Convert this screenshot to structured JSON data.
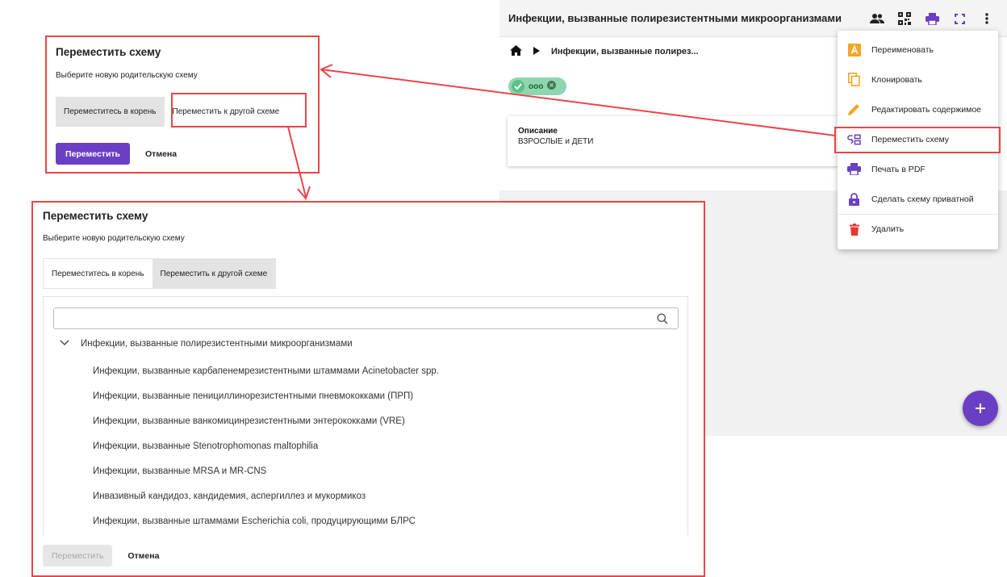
{
  "app": {
    "title": "Инфекции, вызванные полирезистентными микроорганизмами",
    "breadcrumb": "Инфекции, вызванные полирез...",
    "chip_label": "ооо",
    "card_heading": "Описание",
    "card_value": "ВЗРОСЛЫЕ и ДЕТИ",
    "icons": [
      "people-icon",
      "qr-code-icon",
      "print-icon",
      "fullscreen-icon",
      "more-vert-icon"
    ]
  },
  "menu": {
    "items": [
      {
        "label": "Переименовать",
        "icon": "rename-icon"
      },
      {
        "label": "Клонировать",
        "icon": "copy-icon"
      },
      {
        "label": "Редактировать содержимое",
        "icon": "edit-pencil-icon"
      },
      {
        "label": "Переместить схему",
        "icon": "move-scheme-icon"
      },
      {
        "label": "Печать в PDF",
        "icon": "print-icon"
      },
      {
        "label": "Сделать схему приватной",
        "icon": "lock-icon"
      },
      {
        "label": "Удалить",
        "icon": "trash-icon"
      }
    ]
  },
  "small_dialog": {
    "title": "Переместить схему",
    "subtitle": "Выберите новую родительскую схему",
    "tab_root": "Переместитесь в корень",
    "tab_other": "Переместить к другой схеме",
    "move_button": "Переместить",
    "cancel_button": "Отмена"
  },
  "large_dialog": {
    "title": "Переместить схему",
    "subtitle": "Выберите новую родительскую схему",
    "tab_root": "Переместитесь в корень",
    "tab_other": "Переместить к другой схеме",
    "search_value": "",
    "tree_root": "Инфекции, вызванные полирезистентными микроорганизмами",
    "tree_children": [
      "Инфекции, вызванные карбапенемрезистентными штаммами Acinetobacter spp.",
      "Инфекции, вызванные пенициллинорезистентными пневмококками (ПРП)",
      "Инфекции, вызванные ванкомицинрезистентными энтерококками (VRE)",
      "Инфекции, вызванные Stenotrophomonas maltophilia",
      "Инфекции, вызванные MRSA и MR-CNS",
      "Инвазивный кандидоз, кандидемия, аспергиллез и мукормикоз",
      "Инфекции, вызванные штаммами Escherichia coli, продуцирующими БЛРС"
    ],
    "move_button": "Переместить",
    "cancel_button": "Отмена"
  },
  "colors": {
    "accent": "#6a3fc4",
    "annotation": "#e8454a",
    "chip": "#8fd6b0",
    "rename_icon": "#f5a623",
    "copy_icon": "#f5a623",
    "edit_icon": "#f5a623",
    "delete_icon": "#e53935"
  }
}
